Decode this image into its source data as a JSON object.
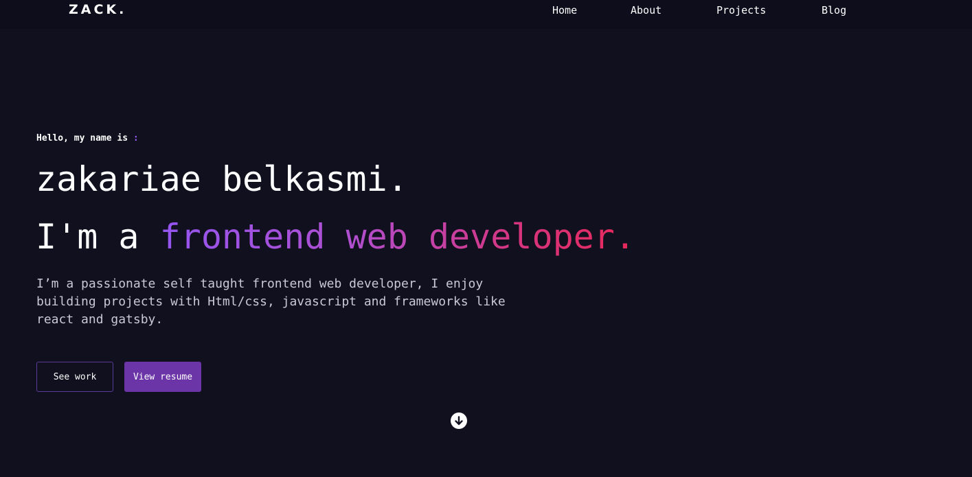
{
  "header": {
    "logo": "ZACK.",
    "nav": [
      {
        "label": "Home"
      },
      {
        "label": "About"
      },
      {
        "label": "Projects"
      },
      {
        "label": "Blog"
      }
    ]
  },
  "hero": {
    "greeting": "Hello, my name is",
    "greeting_colon": ":",
    "name": "zakariae belkasmi.",
    "role_prefix": "I'm a ",
    "role_highlight": "frontend web developer.",
    "bio": "I’m a passionate self taught frontend web developer, I enjoy building projects with Html/css, javascript and frameworks like react and gatsby.",
    "buttons": {
      "see_work": "See work",
      "view_resume": "View resume"
    },
    "scroll_icon": "arrow-down-circle-icon"
  },
  "colors": {
    "background": "#10101f",
    "navbar": "#0d0d1c",
    "accent_purple": "#6b35a8",
    "gradient_start": "#9455f0",
    "gradient_end": "#e8285a"
  }
}
